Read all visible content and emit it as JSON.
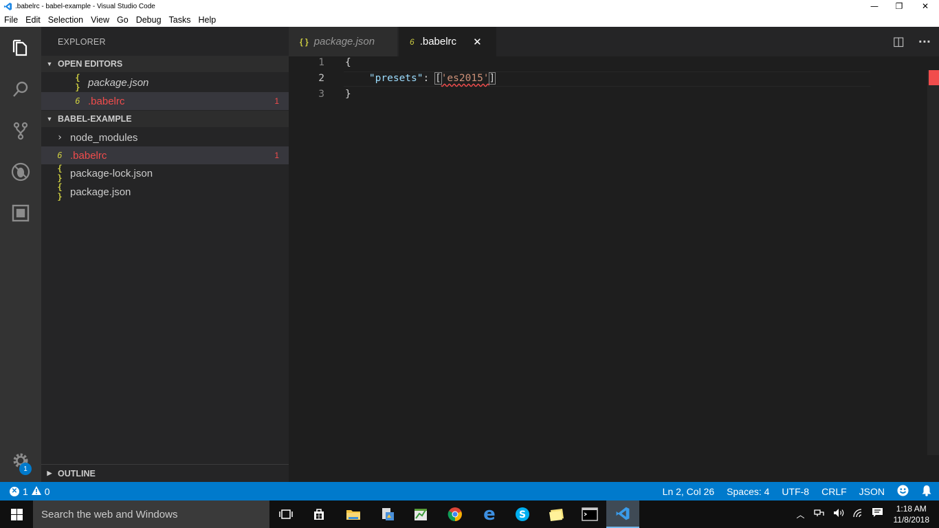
{
  "window": {
    "title": ".babelrc - babel-example - Visual Studio Code",
    "minimize": "—",
    "restore": "❐",
    "close": "✕"
  },
  "menu": [
    "File",
    "Edit",
    "Selection",
    "View",
    "Go",
    "Debug",
    "Tasks",
    "Help"
  ],
  "activity_bar": {
    "icons": [
      "explorer-icon",
      "search-icon",
      "source-control-icon",
      "debug-icon",
      "extensions-icon",
      "gear-icon"
    ],
    "settings_badge": "1"
  },
  "sidebar": {
    "title": "EXPLORER",
    "open_editors": {
      "header": "OPEN EDITORS",
      "items": [
        {
          "icon": "{ }",
          "label": "package.json",
          "problems": ""
        },
        {
          "icon": "6",
          "label": ".babelrc",
          "problems": "1"
        }
      ]
    },
    "project": {
      "header": "BABEL-EXAMPLE",
      "items": [
        {
          "icon": "›",
          "label": "node_modules",
          "problems": ""
        },
        {
          "icon": "6",
          "label": ".babelrc",
          "problems": "1"
        },
        {
          "icon": "{ }",
          "label": "package-lock.json",
          "problems": ""
        },
        {
          "icon": "{ }",
          "label": "package.json",
          "problems": ""
        }
      ]
    },
    "outline_header": "OUTLINE"
  },
  "tabs": [
    {
      "icon": "{ }",
      "label": "package.json",
      "active": false
    },
    {
      "icon": "6",
      "label": ".babelrc",
      "active": true,
      "close": "✕"
    }
  ],
  "tab_actions": {
    "split": "◫",
    "more": "···"
  },
  "editor": {
    "line_numbers": [
      "1",
      "2",
      "3"
    ],
    "lines": {
      "l1": "{",
      "l2_indent": "    ",
      "l2_key": "\"presets\"",
      "l2_colon": ": ",
      "l2_open": "[",
      "l2_value": "'es2015'",
      "l2_close": "]",
      "l3": "}"
    }
  },
  "statusbar": {
    "errors": "1",
    "warnings": "0",
    "position": "Ln 2, Col 26",
    "spaces": "Spaces: 4",
    "encoding": "UTF-8",
    "eol": "CRLF",
    "language": "JSON"
  },
  "taskbar": {
    "search_placeholder": "Search the web and Windows",
    "time": "1:18 AM",
    "date": "11/8/2018"
  },
  "colors": {
    "accent": "#007acc",
    "error": "#f14c4c",
    "json_icon": "#cbcb41"
  }
}
